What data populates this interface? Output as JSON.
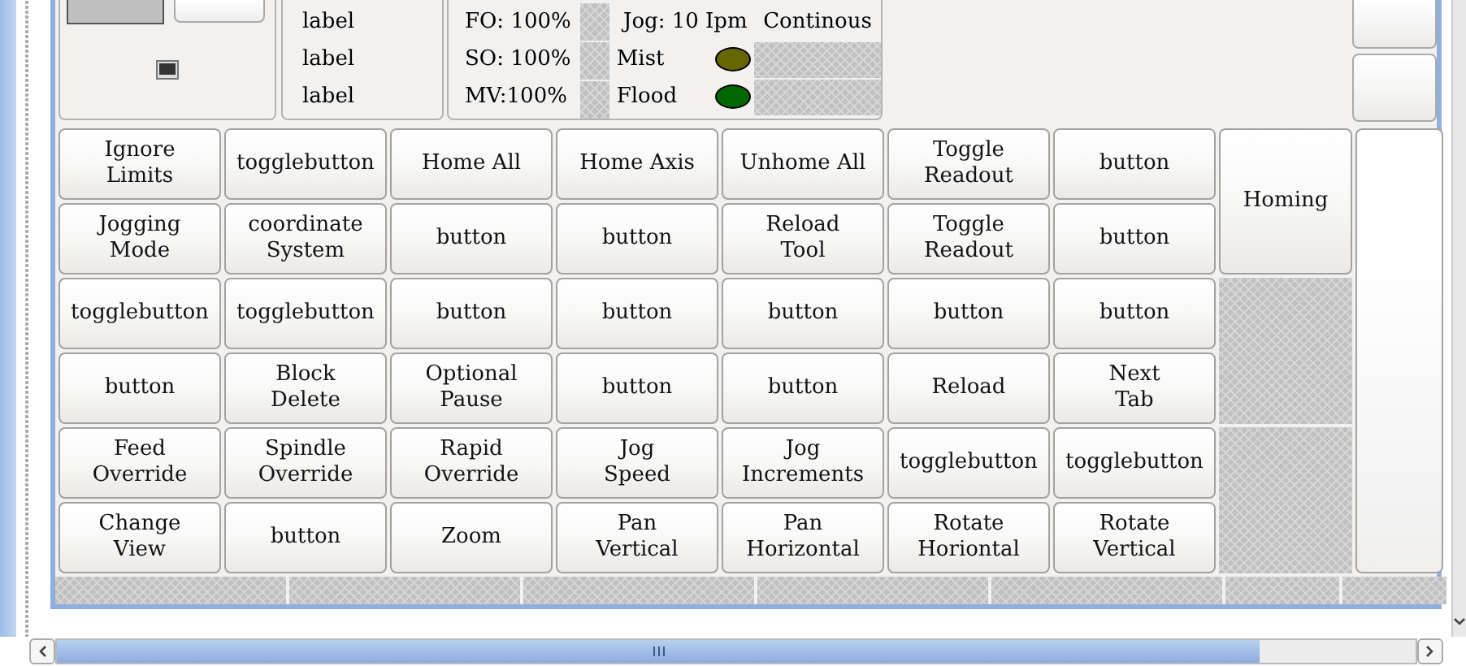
{
  "labels": [
    "label",
    "label",
    "label"
  ],
  "overrides": [
    "FO: 100%",
    "SO: 100%",
    "MV:100%"
  ],
  "jog_rate": "Jog: 10 Ipm",
  "jog_mode": "Continous",
  "coolant": [
    {
      "label": "Mist",
      "color": "#666600"
    },
    {
      "label": "Flood",
      "color": "#006600"
    }
  ],
  "button_grid": [
    [
      "Ignore\nLimits",
      "togglebutton",
      "Home All",
      "Home Axis",
      "Unhome All",
      "Toggle\nReadout",
      "button"
    ],
    [
      "Jogging\nMode",
      "coordinate\nSystem",
      "button",
      "button",
      "Reload\nTool",
      "Toggle\nReadout",
      "button"
    ],
    [
      "togglebutton",
      "togglebutton",
      "button",
      "button",
      "button",
      "button",
      "button"
    ],
    [
      "button",
      "Block\nDelete",
      "Optional\nPause",
      "button",
      "button",
      "Reload",
      "Next\nTab"
    ],
    [
      "Feed\nOverride",
      "Spindle\nOverride",
      "Rapid\nOverride",
      "Jog\nSpeed",
      "Jog\nIncrements",
      "togglebutton",
      "togglebutton"
    ],
    [
      "Change\nView",
      "button",
      "Zoom",
      "Pan\nVertical",
      "Pan\nHorizontal",
      "Rotate\nHoriontal",
      "Rotate\nVertical"
    ]
  ],
  "side_button": "Homing"
}
